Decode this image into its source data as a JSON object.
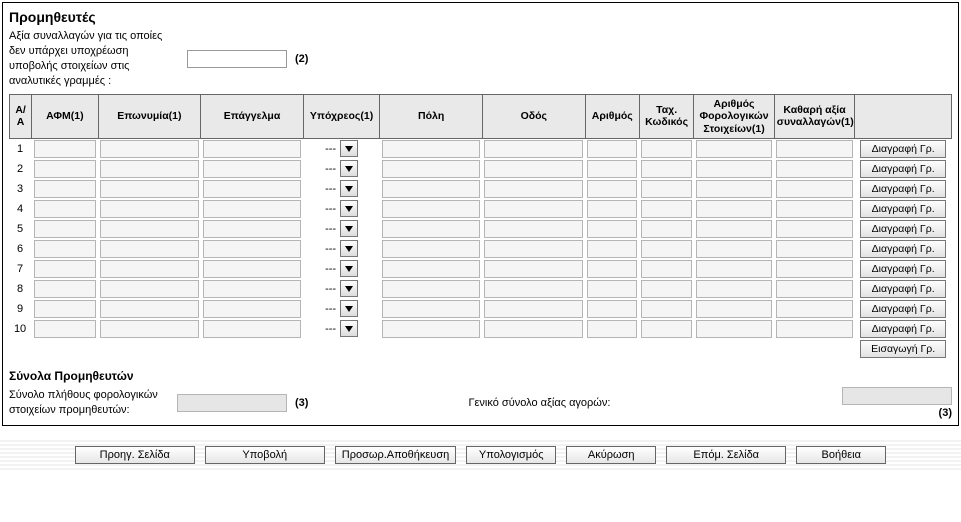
{
  "section": {
    "title": "Προμηθευτές",
    "intro_label": "Αξία συναλλαγών για τις οποίες δεν υπάρχει υποχρέωση υποβολής στοιχείων στις αναλυτικές γραμμές :",
    "intro_note": "(2)"
  },
  "columns": {
    "aa": "Α/Α",
    "afm": "ΑΦΜ(1)",
    "eponymia": "Επωνυμία(1)",
    "epaggelma": "Επάγγελμα",
    "ypoxreos": "Υπόχρεος(1)",
    "poli": "Πόλη",
    "odos": "Οδός",
    "arithmos": "Αριθμός",
    "tk": "Ταχ. Κωδικός",
    "arith_stoix": "Αριθμός Φορολογικών Στοιχείων(1)",
    "kath_axia": "Καθαρή αξία συναλλαγών(1)",
    "actions": ""
  },
  "rows": [
    {
      "n": "1",
      "ypoxreos": "---"
    },
    {
      "n": "2",
      "ypoxreos": "---"
    },
    {
      "n": "3",
      "ypoxreos": "---"
    },
    {
      "n": "4",
      "ypoxreos": "---"
    },
    {
      "n": "5",
      "ypoxreos": "---"
    },
    {
      "n": "6",
      "ypoxreos": "---"
    },
    {
      "n": "7",
      "ypoxreos": "---"
    },
    {
      "n": "8",
      "ypoxreos": "---"
    },
    {
      "n": "9",
      "ypoxreos": "---"
    },
    {
      "n": "10",
      "ypoxreos": "---"
    }
  ],
  "buttons": {
    "delete_row": "Διαγραφή Γρ.",
    "insert_row": "Εισαγωγή Γρ."
  },
  "totals": {
    "title": "Σύνολα Προμηθευτών",
    "left_label": "Σύνολο πλήθους φορολογικών στοιχείων προμηθευτών:",
    "left_note": "(3)",
    "mid_label": "Γενικό σύνολο αξίας αγορών:",
    "right_note": "(3)"
  },
  "footer": {
    "prev": "Προηγ. Σελίδα",
    "submit": "Υποβολή",
    "tempsave": "Προσωρ.Αποθήκευση",
    "calc": "Υπολογισμός",
    "cancel": "Ακύρωση",
    "next": "Επόμ. Σελίδα",
    "help": "Βοήθεια"
  }
}
